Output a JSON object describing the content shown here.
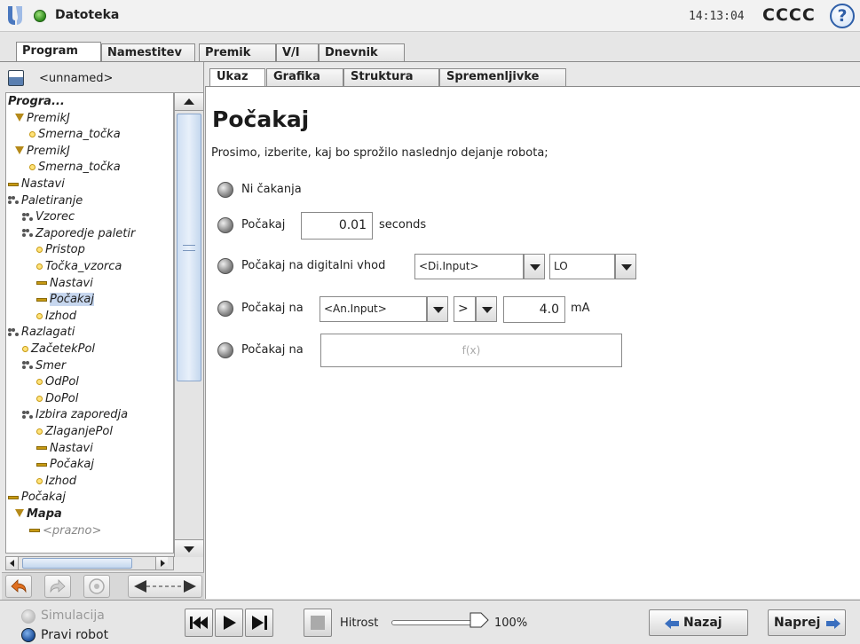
{
  "topbar": {
    "title": "Datoteka",
    "time": "14:13:04",
    "robot_name": "CCCC",
    "help_label": "?"
  },
  "main_tabs": [
    "Program",
    "Namestitev",
    "Premik",
    "V/I",
    "Dnevnik"
  ],
  "program": {
    "name": "<unnamed>"
  },
  "tree": [
    {
      "label": "Progra...",
      "icon": "none",
      "style": "bold"
    },
    {
      "label": "PremikJ",
      "icon": "move-triangle-icon"
    },
    {
      "label": "Smerna_točka",
      "icon": "waypoint-icon"
    },
    {
      "label": "PremikJ",
      "icon": "move-triangle-icon"
    },
    {
      "label": "Smerna_točka",
      "icon": "waypoint-icon"
    },
    {
      "label": "Nastavi",
      "icon": "set-bar-icon"
    },
    {
      "label": "Paletiranje",
      "icon": "pallet-icon"
    },
    {
      "label": "Vzorec",
      "icon": "pallet-icon"
    },
    {
      "label": "Zaporedje paletir",
      "icon": "pallet-icon"
    },
    {
      "label": "Pristop",
      "icon": "waypoint-icon"
    },
    {
      "label": "Točka_vzorca",
      "icon": "waypoint-icon"
    },
    {
      "label": "Nastavi",
      "icon": "set-bar-icon"
    },
    {
      "label": "Počakaj",
      "icon": "set-bar-icon",
      "selected": true
    },
    {
      "label": "Izhod",
      "icon": "waypoint-icon"
    },
    {
      "label": "Razlagati",
      "icon": "pallet-icon"
    },
    {
      "label": "ZačetekPol",
      "icon": "waypoint-icon"
    },
    {
      "label": "Smer",
      "icon": "pallet-icon"
    },
    {
      "label": "OdPol",
      "icon": "waypoint-icon"
    },
    {
      "label": "DoPol",
      "icon": "waypoint-icon"
    },
    {
      "label": "Izbira zaporedja",
      "icon": "pallet-icon"
    },
    {
      "label": "ZlaganjePol",
      "icon": "waypoint-icon"
    },
    {
      "label": "Nastavi",
      "icon": "set-bar-icon"
    },
    {
      "label": "Počakaj",
      "icon": "set-bar-icon"
    },
    {
      "label": "Izhod",
      "icon": "waypoint-icon"
    },
    {
      "label": "Počakaj",
      "icon": "set-bar-icon"
    },
    {
      "label": "Mapa",
      "icon": "move-triangle-icon",
      "style": "bold"
    },
    {
      "label": "<prazno>",
      "icon": "set-bar-icon",
      "style": "grey"
    }
  ],
  "sub_tabs": [
    "Ukaz",
    "Grafika",
    "Struktura",
    "Spremenljivke"
  ],
  "command": {
    "title": "Počakaj",
    "description": "Prosimo, izberite, kaj bo sprožilo naslednjo dejanje robota;",
    "opt_none": "Ni čakanja",
    "opt_wait": "Počakaj",
    "wait_value": "0.01",
    "wait_unit": "seconds",
    "opt_digital": "Počakaj na digitalni vhod",
    "digital_input": "<Di.Input>",
    "digital_level": "LO",
    "opt_analog": "Počakaj na",
    "analog_input": "<An.Input>",
    "analog_op": ">",
    "analog_value": "4.0",
    "analog_unit": "mA",
    "opt_expr": "Počakaj na",
    "expr_placeholder": "f(x)"
  },
  "footer": {
    "sim_label": "Simulacija",
    "real_label": "Pravi robot",
    "speed_label": "Hitrost",
    "speed_value": "100%",
    "speed_fraction": 1.0,
    "back_label": "Nazaj",
    "next_label": "Naprej"
  },
  "colors": {
    "accent": "#2f5fa8",
    "selection": "#c7d7ef",
    "status_ok": "#2e8a1c"
  }
}
